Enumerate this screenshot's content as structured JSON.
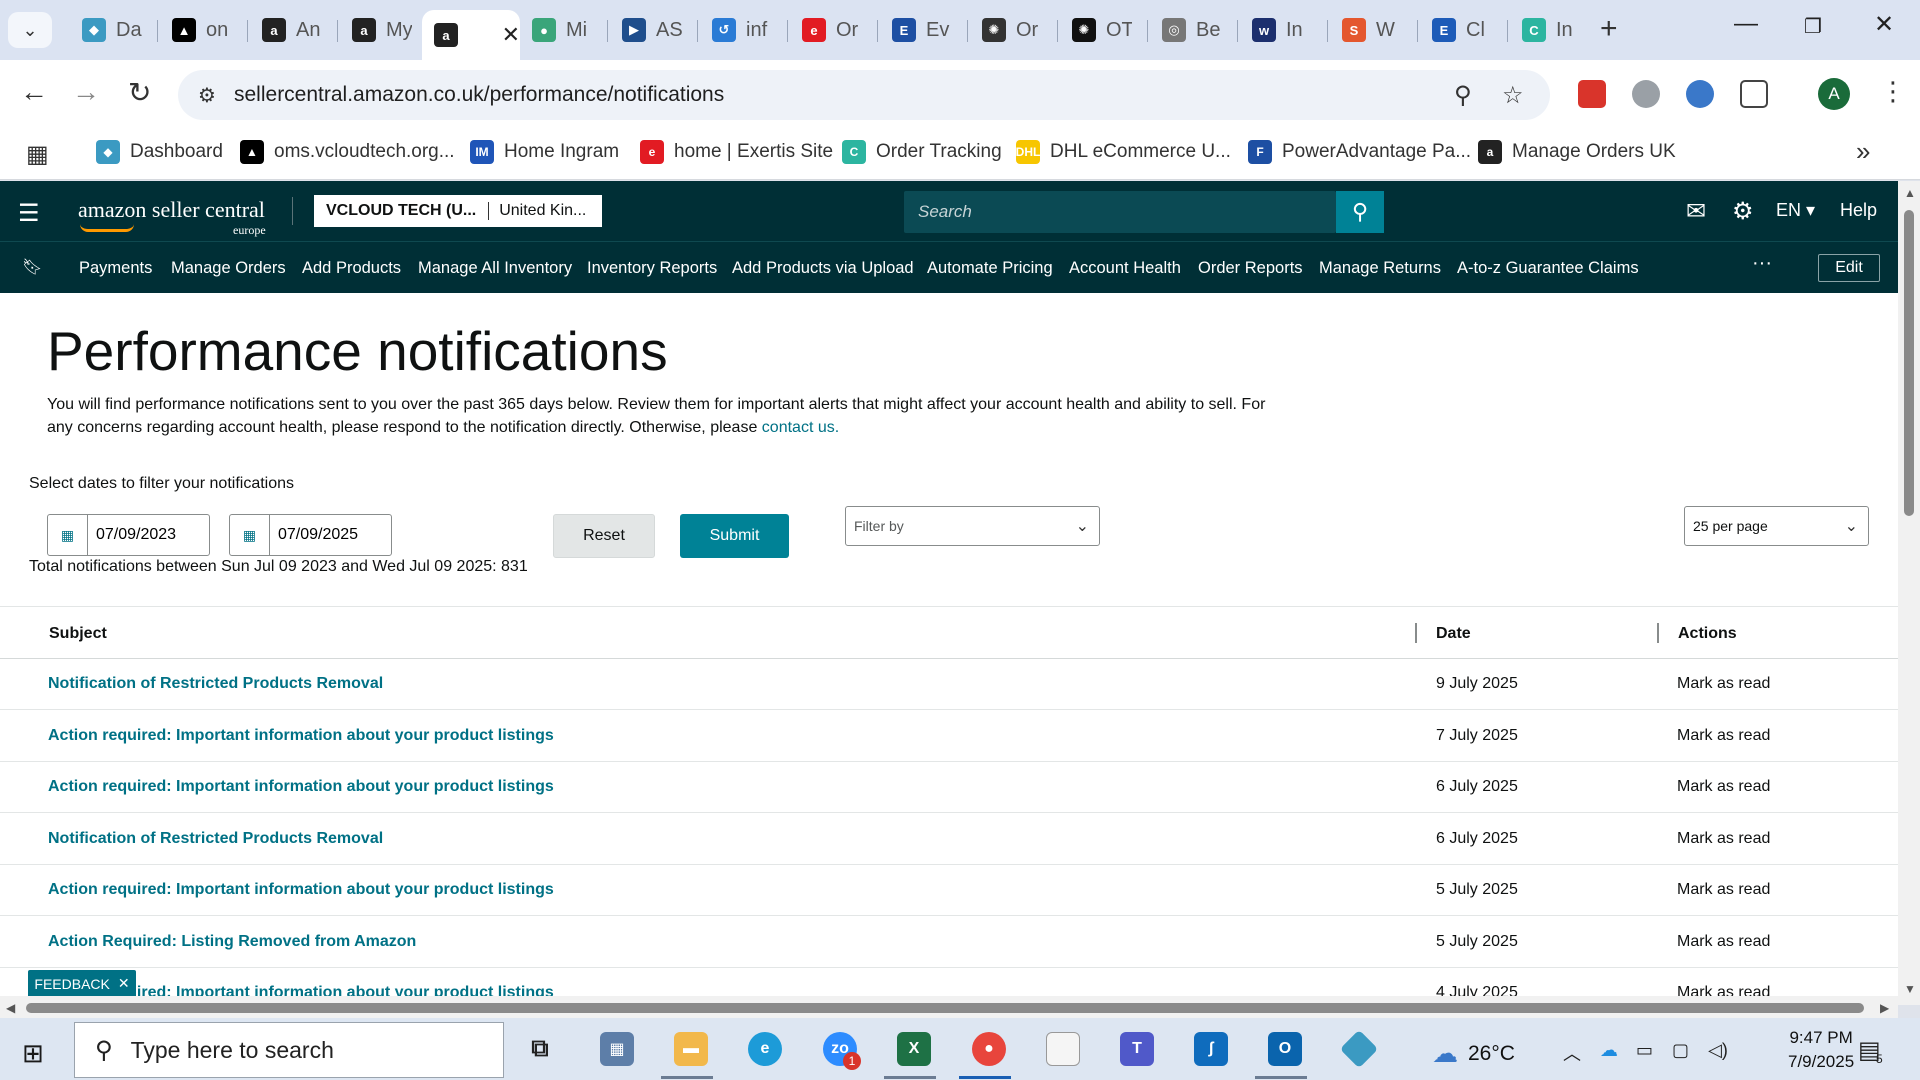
{
  "browser": {
    "tabs": [
      {
        "label": "Da",
        "icon": "generic-tab-icon",
        "color": "#3b9ac2",
        "glyph": "◆"
      },
      {
        "label": "on",
        "icon": "generic-tab-icon",
        "color": "#000000",
        "glyph": "▲"
      },
      {
        "label": "An",
        "icon": "amazon-tab-icon",
        "color": "#222222",
        "glyph": "a"
      },
      {
        "label": "My",
        "icon": "amazon-tab-icon",
        "color": "#222222",
        "glyph": "a"
      },
      {
        "label": "",
        "icon": "amazon-tab-icon",
        "color": "#222222",
        "glyph": "a",
        "active": true
      },
      {
        "label": "Mi",
        "icon": "generic-tab-icon",
        "color": "#3aa57a",
        "glyph": "●"
      },
      {
        "label": "AS",
        "icon": "generic-tab-icon",
        "color": "#1f4e8c",
        "glyph": "▶"
      },
      {
        "label": "inf",
        "icon": "generic-tab-icon",
        "color": "#2a7bd5",
        "glyph": "↺"
      },
      {
        "label": "Or",
        "icon": "generic-tab-icon",
        "color": "#e21b23",
        "glyph": "e"
      },
      {
        "label": "Ev",
        "icon": "generic-tab-icon",
        "color": "#1d4fa3",
        "glyph": "E"
      },
      {
        "label": "Or",
        "icon": "generic-tab-icon",
        "color": "#333333",
        "glyph": "✺"
      },
      {
        "label": "OT",
        "icon": "generic-tab-icon",
        "color": "#111111",
        "glyph": "✺"
      },
      {
        "label": "Be",
        "icon": "generic-tab-icon",
        "color": "#777777",
        "glyph": "◎"
      },
      {
        "label": "In",
        "icon": "generic-tab-icon",
        "color": "#1c2f6e",
        "glyph": "w"
      },
      {
        "label": "W",
        "icon": "generic-tab-icon",
        "color": "#e4572e",
        "glyph": "S"
      },
      {
        "label": "Cl",
        "icon": "generic-tab-icon",
        "color": "#1d5bb8",
        "glyph": "E"
      },
      {
        "label": "In",
        "icon": "generic-tab-icon",
        "color": "#2cb5a0",
        "glyph": "C"
      }
    ],
    "url": "sellercentral.amazon.co.uk/performance/notifications",
    "bookmarks": [
      {
        "label": "Dashboard",
        "color": "#3b9ac2",
        "glyph": "◆"
      },
      {
        "label": "oms.vcloudtech.org...",
        "color": "#000000",
        "glyph": "▲"
      },
      {
        "label": "Home Ingram",
        "color": "#1f55b8",
        "glyph": "IM"
      },
      {
        "label": "home | Exertis Site",
        "color": "#e21b23",
        "glyph": "e"
      },
      {
        "label": "Order Tracking",
        "color": "#2cb5a0",
        "glyph": "C"
      },
      {
        "label": "DHL eCommerce U...",
        "color": "#f7c600",
        "glyph": "DHL"
      },
      {
        "label": "PowerAdvantage Pa...",
        "color": "#1d4fa3",
        "glyph": "F"
      },
      {
        "label": "Manage Orders UK",
        "color": "#222222",
        "glyph": "a"
      }
    ],
    "more_bookmarks": "»"
  },
  "header": {
    "logo_text": "amazon seller central",
    "logo_sub": "europe",
    "account_name": "VCLOUD TECH (U...",
    "account_country": "United Kin...",
    "search_placeholder": "Search",
    "language": "EN ▾",
    "help": "Help"
  },
  "nav": {
    "items": [
      "Payments",
      "Manage Orders",
      "Add Products",
      "Manage All Inventory",
      "Inventory Reports",
      "Add Products via Upload",
      "Automate Pricing",
      "Account Health",
      "Order Reports",
      "Manage Returns",
      "A-to-z Guarantee Claims"
    ],
    "more": "···",
    "edit": "Edit"
  },
  "page": {
    "title": "Performance notifications",
    "intro": "You will find performance notifications sent to you over the past 365 days below. Review them for important alerts that might affect your account health and ability to sell. For any concerns regarding account health, please respond to the notification directly. Otherwise, please ",
    "contact_link": "contact us.",
    "filter_label": "Select dates to filter your notifications",
    "date_from": "07/09/2023",
    "date_to": "07/09/2025",
    "reset": "Reset",
    "submit": "Submit",
    "filter_by": "Filter by",
    "per_page": "25 per page",
    "total": "Total notifications between Sun Jul 09 2023 and Wed Jul 09 2025: 831",
    "feedback": "FEEDBACK"
  },
  "table": {
    "headers": {
      "subject": "Subject",
      "date": "Date",
      "actions": "Actions"
    },
    "rows": [
      {
        "subject": "Notification of Restricted Products Removal",
        "date": "9 July 2025",
        "action": "Mark as read"
      },
      {
        "subject": "Action required: Important information about your product listings",
        "date": "7 July 2025",
        "action": "Mark as read"
      },
      {
        "subject": "Action required: Important information about your product listings",
        "date": "6 July 2025",
        "action": "Mark as read"
      },
      {
        "subject": "Notification of Restricted Products Removal",
        "date": "6 July 2025",
        "action": "Mark as read"
      },
      {
        "subject": "Action required: Important information about your product listings",
        "date": "5 July 2025",
        "action": "Mark as read"
      },
      {
        "subject": "Action Required: Listing Removed from Amazon",
        "date": "5 July 2025",
        "action": "Mark as read"
      },
      {
        "subject": "Action required: Important information about your product listings",
        "date": "4 July 2025",
        "action": "Mark as read"
      }
    ]
  },
  "taskbar": {
    "search_placeholder": "Type here to search",
    "temperature": "26°C",
    "time": "9:47 PM",
    "date": "7/9/2025",
    "notifications_count": "5",
    "zoom_badge": "1"
  },
  "colors": {
    "header_bg": "#002f36",
    "accent": "#008296",
    "link": "#007185"
  }
}
